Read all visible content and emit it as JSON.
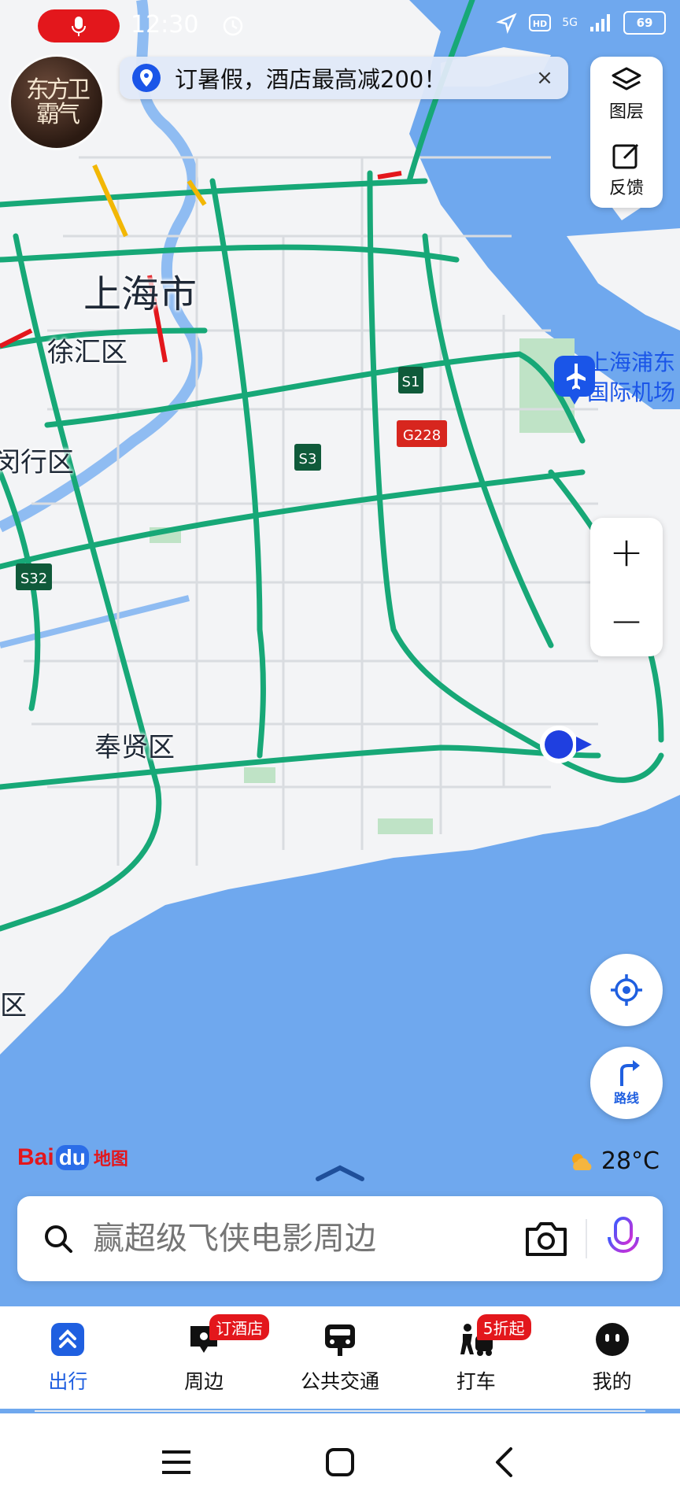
{
  "status_bar": {
    "time": "12:30",
    "battery": "69",
    "network": "5G"
  },
  "promo_banner": {
    "text": "订暑假，酒店最高减200！",
    "close": "×"
  },
  "map_tools": {
    "layers_label": "图层",
    "feedback_label": "反馈",
    "zoom_in": "+",
    "zoom_out": "−",
    "route_label": "路线"
  },
  "map_labels": {
    "city": "上海市",
    "xuhui": "徐汇区",
    "minhang": "闵行区",
    "fengxian": "奉贤区",
    "edge_district": "区",
    "airport_line1": "上海浦东",
    "airport_line2": "国际机场",
    "shield_s1": "S1",
    "shield_s3": "S3",
    "shield_s32": "S32",
    "shield_g228": "G228"
  },
  "avatar_text": {
    "line1": "东方卫",
    "line2": "霸气"
  },
  "logo": {
    "bai": "Bai",
    "du": "du",
    "di": "地图"
  },
  "weather": {
    "temp": "28°C"
  },
  "search": {
    "placeholder": "赢超级飞侠电影周边"
  },
  "tabs": [
    {
      "label": "出行",
      "badge": ""
    },
    {
      "label": "周边",
      "badge": "订酒店"
    },
    {
      "label": "公共交通",
      "badge": ""
    },
    {
      "label": "打车",
      "badge": "5折起"
    },
    {
      "label": "我的",
      "badge": ""
    }
  ],
  "colors": {
    "sea": "#6fa8ee",
    "land": "#f3f4f6",
    "road_green": "#17a877",
    "brand_blue": "#1f5fe0",
    "brand_red": "#e3171c"
  }
}
